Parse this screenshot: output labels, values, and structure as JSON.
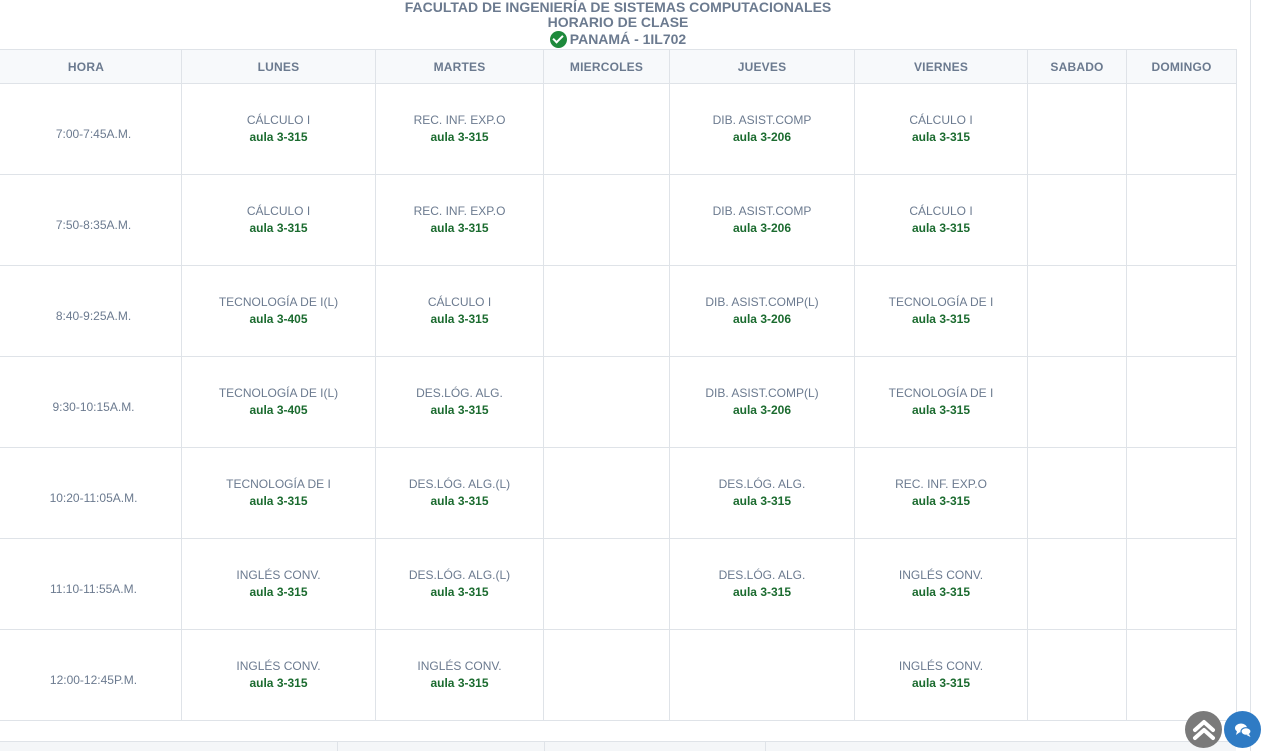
{
  "header": {
    "line1": "FACULTAD DE INGENIERÍA DE SISTEMAS COMPUTACIONALES",
    "line2": "HORARIO DE CLASE",
    "line3": "PANAMÁ - 1IL702"
  },
  "columns": [
    "HORA",
    "LUNES",
    "MARTES",
    "MIERCOLES",
    "JUEVES",
    "VIERNES",
    "SABADO",
    "DOMINGO"
  ],
  "rows": [
    {
      "time": "7:00-7:45A.M.",
      "cells": [
        {
          "course": "CÁLCULO I",
          "room": "aula 3-315"
        },
        {
          "course": "REC. INF. EXP.O",
          "room": "aula 3-315"
        },
        {
          "course": "",
          "room": ""
        },
        {
          "course": "DIB. ASIST.COMP",
          "room": "aula 3-206"
        },
        {
          "course": "CÁLCULO I",
          "room": "aula 3-315"
        },
        {
          "course": "",
          "room": ""
        },
        {
          "course": "",
          "room": ""
        }
      ]
    },
    {
      "time": "7:50-8:35A.M.",
      "cells": [
        {
          "course": "CÁLCULO I",
          "room": "aula 3-315"
        },
        {
          "course": "REC. INF. EXP.O",
          "room": "aula 3-315"
        },
        {
          "course": "",
          "room": ""
        },
        {
          "course": "DIB. ASIST.COMP",
          "room": "aula 3-206"
        },
        {
          "course": "CÁLCULO I",
          "room": "aula 3-315"
        },
        {
          "course": "",
          "room": ""
        },
        {
          "course": "",
          "room": ""
        }
      ]
    },
    {
      "time": "8:40-9:25A.M.",
      "cells": [
        {
          "course": "TECNOLOGÍA DE I(L)",
          "room": "aula 3-405"
        },
        {
          "course": "CÁLCULO I",
          "room": "aula 3-315"
        },
        {
          "course": "",
          "room": ""
        },
        {
          "course": "DIB. ASIST.COMP(L)",
          "room": "aula 3-206"
        },
        {
          "course": "TECNOLOGÍA DE I",
          "room": "aula 3-315"
        },
        {
          "course": "",
          "room": ""
        },
        {
          "course": "",
          "room": ""
        }
      ]
    },
    {
      "time": "9:30-10:15A.M.",
      "cells": [
        {
          "course": "TECNOLOGÍA DE I(L)",
          "room": "aula 3-405"
        },
        {
          "course": "DES.LÓG. ALG.",
          "room": "aula 3-315"
        },
        {
          "course": "",
          "room": ""
        },
        {
          "course": "DIB. ASIST.COMP(L)",
          "room": "aula 3-206"
        },
        {
          "course": "TECNOLOGÍA DE I",
          "room": "aula 3-315"
        },
        {
          "course": "",
          "room": ""
        },
        {
          "course": "",
          "room": ""
        }
      ]
    },
    {
      "time": "10:20-11:05A.M.",
      "cells": [
        {
          "course": "TECNOLOGÍA DE I",
          "room": "aula 3-315"
        },
        {
          "course": "DES.LÓG. ALG.(L)",
          "room": "aula 3-315"
        },
        {
          "course": "",
          "room": ""
        },
        {
          "course": "DES.LÓG. ALG.",
          "room": "aula 3-315"
        },
        {
          "course": "REC. INF. EXP.O",
          "room": "aula 3-315"
        },
        {
          "course": "",
          "room": ""
        },
        {
          "course": "",
          "room": ""
        }
      ]
    },
    {
      "time": "11:10-11:55A.M.",
      "cells": [
        {
          "course": "INGLÉS CONV.",
          "room": "aula 3-315"
        },
        {
          "course": "DES.LÓG. ALG.(L)",
          "room": "aula 3-315"
        },
        {
          "course": "",
          "room": ""
        },
        {
          "course": "DES.LÓG. ALG.",
          "room": "aula 3-315"
        },
        {
          "course": "INGLÉS CONV.",
          "room": "aula 3-315"
        },
        {
          "course": "",
          "room": ""
        },
        {
          "course": "",
          "room": ""
        }
      ]
    },
    {
      "time": "12:00-12:45P.M.",
      "cells": [
        {
          "course": "INGLÉS CONV.",
          "room": "aula 3-315"
        },
        {
          "course": "INGLÉS CONV.",
          "room": "aula 3-315"
        },
        {
          "course": "",
          "room": ""
        },
        {
          "course": "",
          "room": ""
        },
        {
          "course": "INGLÉS CONV.",
          "room": "aula 3-315"
        },
        {
          "course": "",
          "room": ""
        },
        {
          "course": "",
          "room": ""
        }
      ]
    }
  ],
  "icons": {
    "status": "check-circle-icon",
    "scroll_top": "chevron-up-icon",
    "chat": "chat-bubbles-icon"
  },
  "colors": {
    "header_text": "#6b7a8f",
    "room_text": "#1b6b2f",
    "check": "#1e8a3c",
    "scroll_top_button": "#7a7a7a",
    "chat_button": "#2f7bc4"
  }
}
